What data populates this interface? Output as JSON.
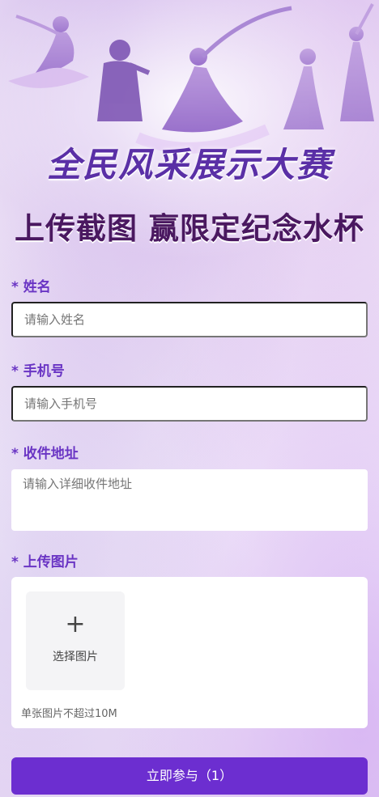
{
  "banner": {
    "title": "全民风采展示大赛",
    "subtitle": "上传截图 赢限定纪念水杯"
  },
  "form": {
    "name": {
      "label": "* 姓名",
      "placeholder": "请输入姓名"
    },
    "phone": {
      "label": "* 手机号",
      "placeholder": "请输入手机号"
    },
    "address": {
      "label": "* 收件地址",
      "placeholder": "请输入详细收件地址"
    },
    "upload": {
      "label": "* 上传图片",
      "plus_glyph": "+",
      "select_text": "选择图片",
      "hint": "单张图片不超过10M"
    }
  },
  "submit": {
    "label": "立即参与（1）"
  },
  "colors": {
    "accent": "#6c2ed0",
    "label": "#6a35c4",
    "title_purple": "#5a2fa6",
    "subtitle_dark": "#4a1860"
  }
}
